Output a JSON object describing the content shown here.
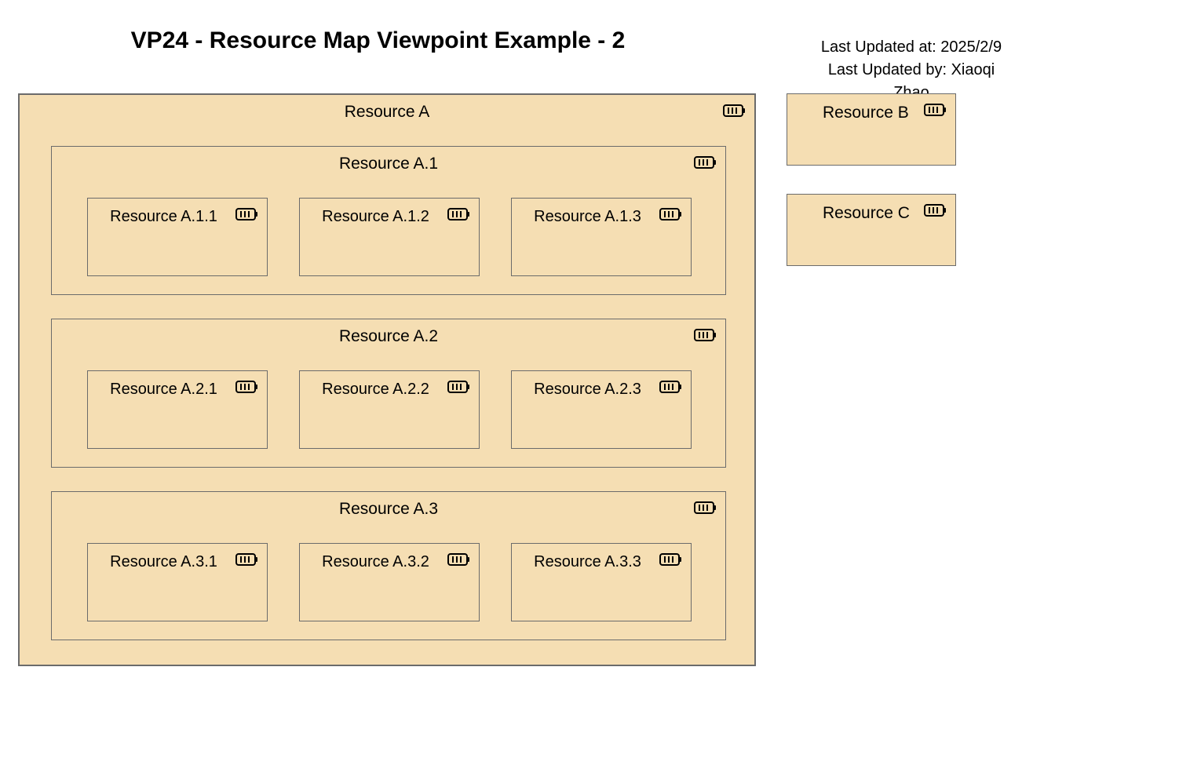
{
  "title": "VP24 - Resource Map Viewpoint Example - 2",
  "meta": {
    "updated_at": "Last Updated at: 2025/2/9",
    "updated_by": "Last Updated by: Xiaoqi Zhao"
  },
  "resourceA": {
    "label": "Resource A",
    "children": [
      {
        "label": "Resource A.1",
        "leaves": [
          {
            "label": "Resource A.1.1"
          },
          {
            "label": "Resource A.1.2"
          },
          {
            "label": "Resource A.1.3"
          }
        ]
      },
      {
        "label": "Resource A.2",
        "leaves": [
          {
            "label": "Resource A.2.1"
          },
          {
            "label": "Resource A.2.2"
          },
          {
            "label": "Resource A.2.3"
          }
        ]
      },
      {
        "label": "Resource A.3",
        "leaves": [
          {
            "label": "Resource A.3.1"
          },
          {
            "label": "Resource A.3.2"
          },
          {
            "label": "Resource A.3.3"
          }
        ]
      }
    ]
  },
  "resourceB": {
    "label": "Resource B"
  },
  "resourceC": {
    "label": "Resource C"
  }
}
